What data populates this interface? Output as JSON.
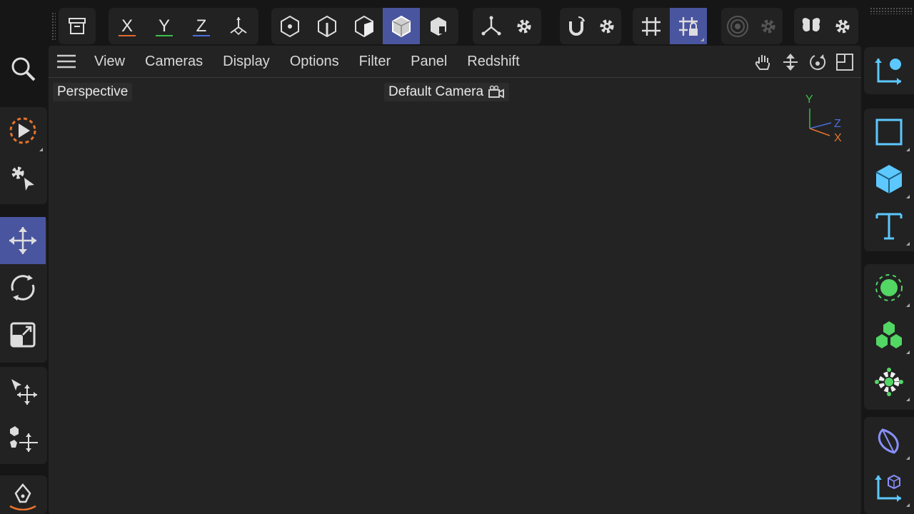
{
  "top_toolbar": {
    "axes": [
      {
        "label": "X",
        "color": "#e0682f"
      },
      {
        "label": "Y",
        "color": "#3bbf48"
      },
      {
        "label": "Z",
        "color": "#4a6ee0"
      }
    ]
  },
  "viewport": {
    "menu": [
      "View",
      "Cameras",
      "Display",
      "Options",
      "Filter",
      "Panel",
      "Redshift"
    ],
    "projection_label": "Perspective",
    "camera_label": "Default Camera",
    "gizmo": {
      "y": "Y",
      "z": "Z",
      "x": "X"
    }
  },
  "colors": {
    "accent": "#4a55a0",
    "object_blue": "#5cc8ff",
    "generator_green": "#52d664",
    "deformer_purple": "#8a90ff",
    "selection_orange": "#e8742c"
  }
}
